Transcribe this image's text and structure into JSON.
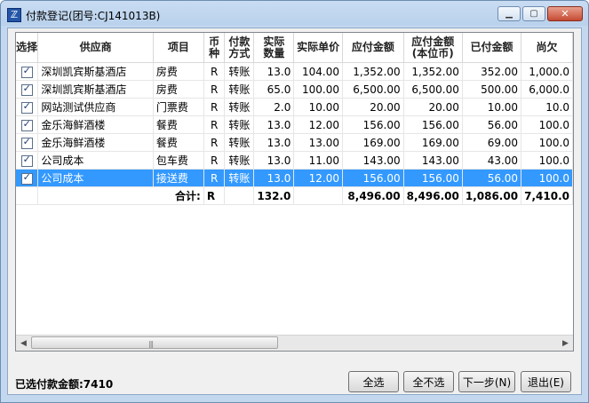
{
  "window": {
    "title": "付款登记(团号:CJ141013B)",
    "controls": [
      "minimize-icon",
      "maximize-icon",
      "close-icon"
    ]
  },
  "table": {
    "columns": [
      {
        "label": "选择"
      },
      {
        "label": "供应商"
      },
      {
        "label": "项目"
      },
      {
        "label": "币种"
      },
      {
        "label": "付款\n方式"
      },
      {
        "label": "实际\n数量"
      },
      {
        "label": "实际单价"
      },
      {
        "label": "应付金额"
      },
      {
        "label": "应付金额\n(本位币)"
      },
      {
        "label": "已付金额"
      },
      {
        "label": "尚欠"
      }
    ],
    "rows": [
      {
        "checked": true,
        "supplier": "深圳凯宾斯基酒店",
        "item": "房费",
        "currency": "R",
        "method": "转账",
        "qty": "13.0",
        "price": "104.00",
        "payable": "1,352.00",
        "payable_base": "1,352.00",
        "paid": "352.00",
        "owed": "1,000.0",
        "selected": false
      },
      {
        "checked": true,
        "supplier": "深圳凯宾斯基酒店",
        "item": "房费",
        "currency": "R",
        "method": "转账",
        "qty": "65.0",
        "price": "100.00",
        "payable": "6,500.00",
        "payable_base": "6,500.00",
        "paid": "500.00",
        "owed": "6,000.0",
        "selected": false
      },
      {
        "checked": true,
        "supplier": "网站测试供应商",
        "item": "门票费",
        "currency": "R",
        "method": "转账",
        "qty": "2.0",
        "price": "10.00",
        "payable": "20.00",
        "payable_base": "20.00",
        "paid": "10.00",
        "owed": "10.0",
        "selected": false
      },
      {
        "checked": true,
        "supplier": "金乐海鲜酒楼",
        "item": "餐费",
        "currency": "R",
        "method": "转账",
        "qty": "13.0",
        "price": "12.00",
        "payable": "156.00",
        "payable_base": "156.00",
        "paid": "56.00",
        "owed": "100.0",
        "selected": false
      },
      {
        "checked": true,
        "supplier": "金乐海鲜酒楼",
        "item": "餐费",
        "currency": "R",
        "method": "转账",
        "qty": "13.0",
        "price": "13.00",
        "payable": "169.00",
        "payable_base": "169.00",
        "paid": "69.00",
        "owed": "100.0",
        "selected": false
      },
      {
        "checked": true,
        "supplier": "公司成本",
        "item": "包车费",
        "currency": "R",
        "method": "转账",
        "qty": "13.0",
        "price": "11.00",
        "payable": "143.00",
        "payable_base": "143.00",
        "paid": "43.00",
        "owed": "100.0",
        "selected": false
      },
      {
        "checked": true,
        "supplier": "公司成本",
        "item": "接送费",
        "currency": "R",
        "method": "转账",
        "qty": "13.0",
        "price": "12.00",
        "payable": "156.00",
        "payable_base": "156.00",
        "paid": "56.00",
        "owed": "100.0",
        "selected": true
      }
    ],
    "total": {
      "label": "合计:",
      "currency": "R",
      "qty": "132.0",
      "payable": "8,496.00",
      "payable_base": "8,496.00",
      "paid": "1,086.00",
      "owed": "7,410.0"
    }
  },
  "footer": {
    "summary": "已选付款金额:7410",
    "buttons": {
      "select_all": "全选",
      "select_none": "全不选",
      "next": "下一步(N)",
      "exit": "退出(E)"
    }
  },
  "colors": {
    "selection": "#3399ff",
    "titlebar": "#c3d8ef"
  }
}
